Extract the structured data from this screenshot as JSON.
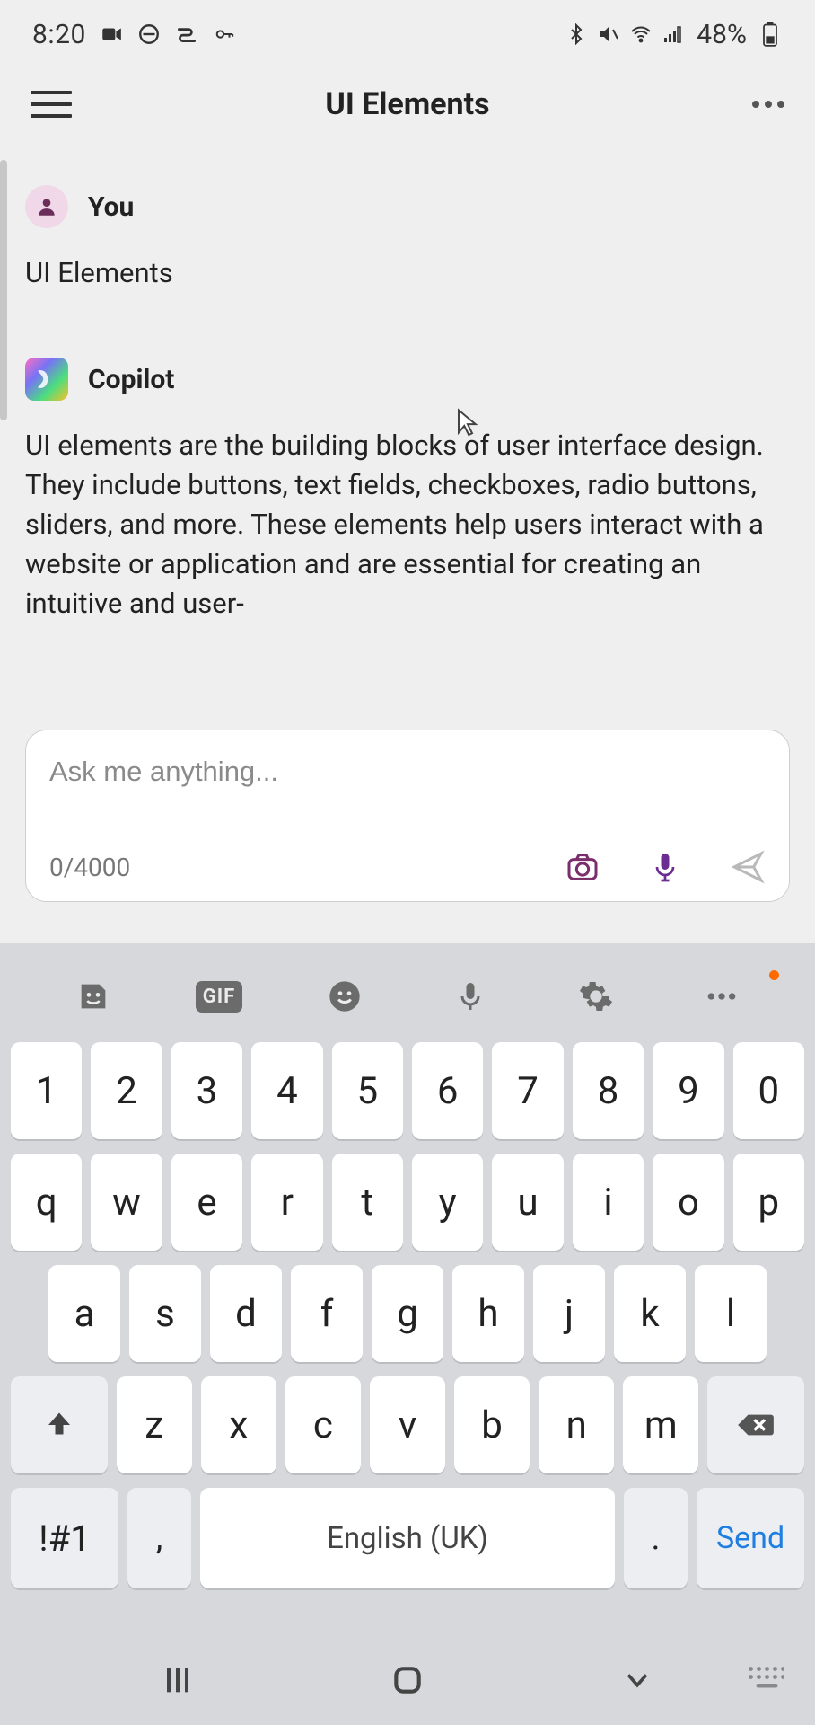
{
  "status": {
    "time": "8:20",
    "battery_pct": "48%"
  },
  "header": {
    "title": "UI Elements"
  },
  "chat": {
    "user": {
      "sender": "You",
      "text": "UI Elements"
    },
    "assistant": {
      "sender": "Copilot",
      "text": "UI elements are the building blocks of user interface design. They include buttons, text fields, checkboxes, radio buttons, sliders, and more. These elements help users interact with a website or application and are essential for creating an intuitive and user-"
    }
  },
  "input": {
    "placeholder": "Ask me anything...",
    "char_count": "0/4000"
  },
  "keyboard": {
    "row_num": [
      "1",
      "2",
      "3",
      "4",
      "5",
      "6",
      "7",
      "8",
      "9",
      "0"
    ],
    "row_q": [
      "q",
      "w",
      "e",
      "r",
      "t",
      "y",
      "u",
      "i",
      "o",
      "p"
    ],
    "row_a": [
      "a",
      "s",
      "d",
      "f",
      "g",
      "h",
      "j",
      "k",
      "l"
    ],
    "row_z": [
      "z",
      "x",
      "c",
      "v",
      "b",
      "n",
      "m"
    ],
    "symbols": "!#1",
    "comma": ",",
    "period": ".",
    "space": "English (UK)",
    "send": "Send",
    "gif": "GIF"
  }
}
